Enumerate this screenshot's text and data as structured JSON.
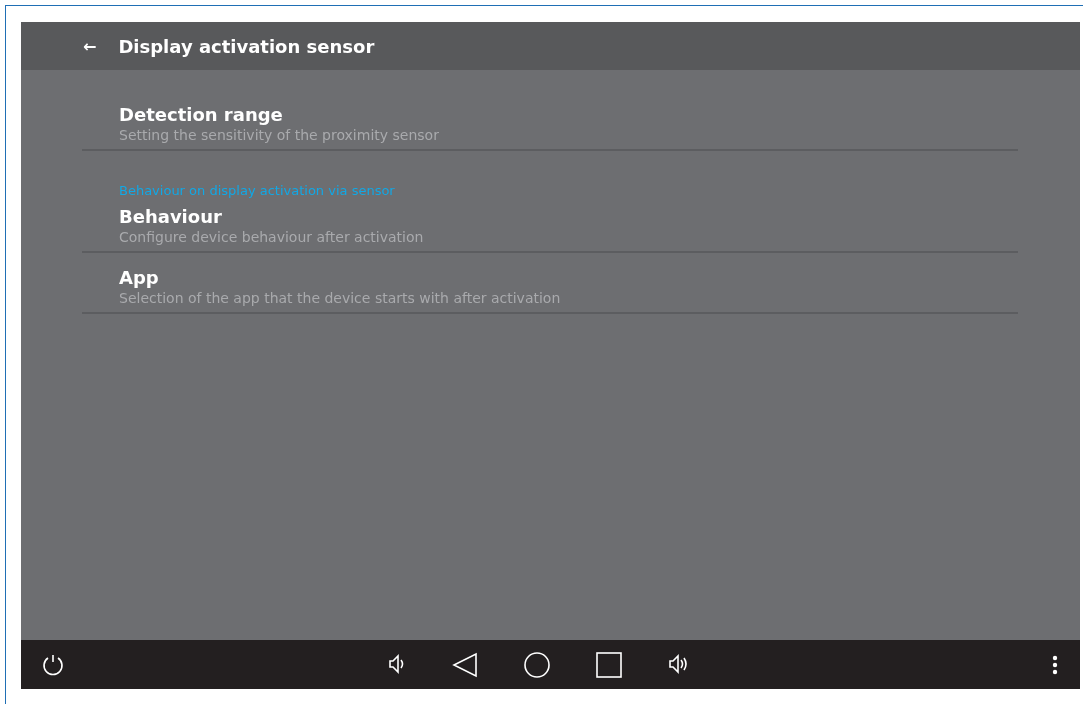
{
  "header": {
    "back": "←",
    "title": "Display activation sensor"
  },
  "list": [
    {
      "kind": "item",
      "title": "Detection range",
      "subtitle": "Setting the sensitivity of the proximity sensor"
    },
    {
      "kind": "section",
      "title": "Behaviour on display activation via sensor"
    },
    {
      "kind": "item",
      "title": "Behaviour",
      "subtitle": "Configure device behaviour after activation"
    },
    {
      "kind": "item",
      "title": "App",
      "subtitle": "Selection of the app that the device starts with after activation"
    }
  ]
}
